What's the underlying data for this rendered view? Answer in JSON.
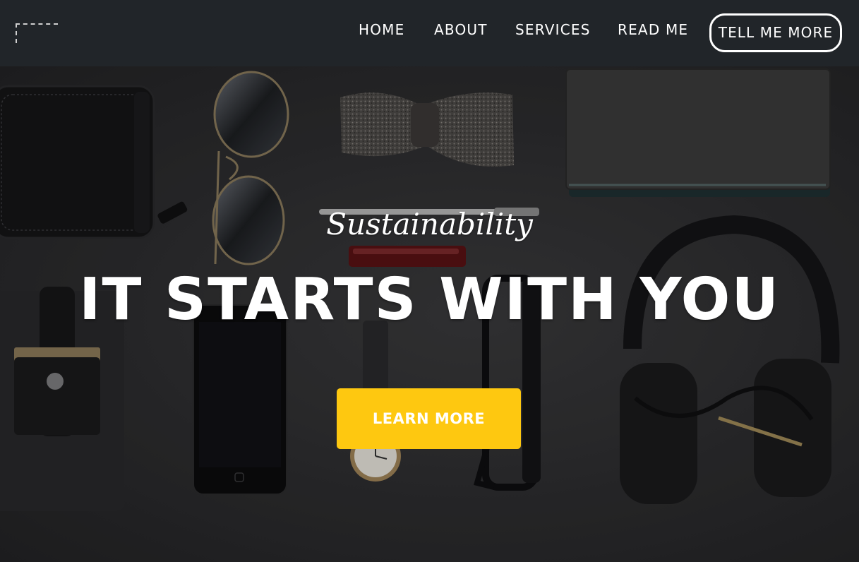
{
  "colors": {
    "navbar_bg": "#212529",
    "accent": "#fec810",
    "text": "#ffffff",
    "hero_bg": "#2d2d2f"
  },
  "navbar": {
    "logo_icon": "logo-dashed-frame-icon",
    "links": [
      {
        "label": "HOME"
      },
      {
        "label": "ABOUT"
      },
      {
        "label": "SERVICES"
      },
      {
        "label": "READ ME"
      }
    ],
    "cta_label": "TELL ME MORE"
  },
  "hero": {
    "subtitle": "Sustainability",
    "title": "IT STARTS WITH YOU",
    "button_label": "LEARN MORE",
    "background_items": [
      "wallet-icon",
      "sunglasses-icon",
      "bow-tie-icon",
      "notebook-icon",
      "pen-icon",
      "lighter-icon",
      "card-holder-icon",
      "smartphone-icon",
      "wristwatch-icon",
      "eyeglasses-icon",
      "headphones-icon"
    ]
  }
}
